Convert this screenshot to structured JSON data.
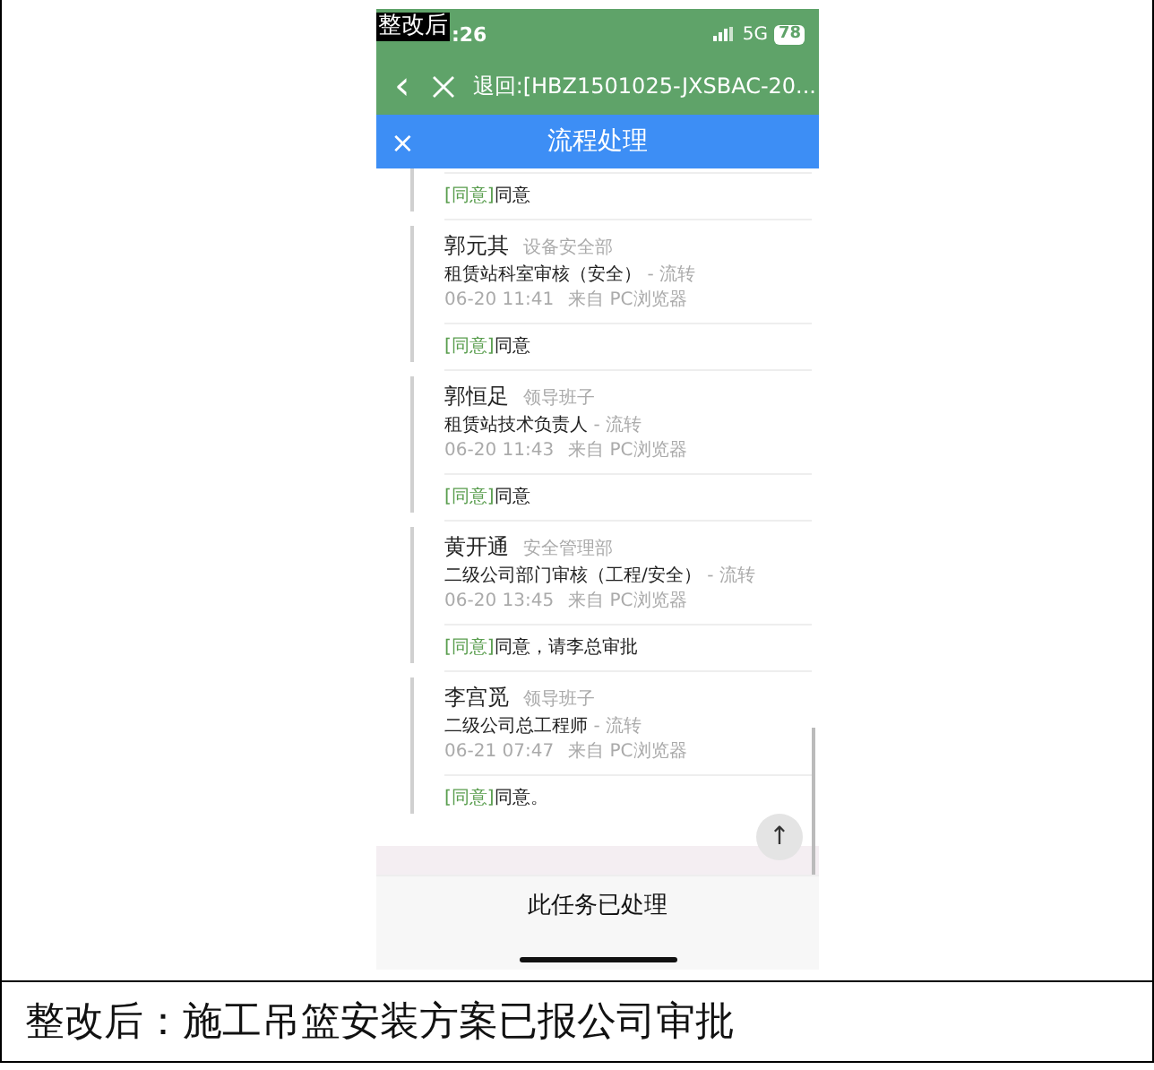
{
  "screenshot": {
    "overlay_label": "整改后",
    "status_bar": {
      "time": ":26",
      "network": "5G",
      "battery": "78"
    },
    "nav_bar": {
      "back_icon": "‹",
      "title": "退回:[HBZ1501025-JXSBAC-20..."
    },
    "header": {
      "close_icon": "×",
      "title": "流程处理"
    },
    "leading_comment": {
      "verdict": "[同意]",
      "comment": "同意"
    },
    "records": [
      {
        "name": "郭元其",
        "dept": "设备安全部",
        "role": "租赁站科室审核（安全）",
        "action": "- 流转",
        "time": "06-20 11:41",
        "source": "来自  PC浏览器",
        "verdict": "[同意]",
        "comment": "同意"
      },
      {
        "name": "郭恒足",
        "dept": "领导班子",
        "role": "租赁站技术负责人",
        "action": "- 流转",
        "time": "06-20 11:43",
        "source": "来自  PC浏览器",
        "verdict": "[同意]",
        "comment": "同意"
      },
      {
        "name": "黄开通",
        "dept": "安全管理部",
        "role": "二级公司部门审核（工程/安全）",
        "action": "- 流转",
        "time": "06-20 13:45",
        "source": "来自  PC浏览器",
        "verdict": "[同意]",
        "comment": "同意，请李总审批"
      },
      {
        "name": "李宫觅",
        "dept": "领导班子",
        "role": "二级公司总工程师",
        "action": "- 流转",
        "time": "06-21 07:47",
        "source": "来自  PC浏览器",
        "verdict": "[同意]",
        "comment": "同意。"
      }
    ],
    "scroll_top_icon": "↑",
    "footer": "此任务已处理"
  },
  "caption": "整改后：施工吊篮安装方案已报公司审批"
}
